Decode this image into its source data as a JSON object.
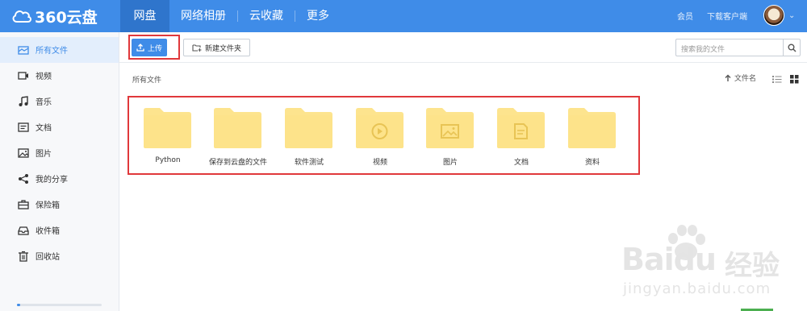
{
  "app": {
    "logo_text": "360云盘",
    "logo_icon": "cloud-icon"
  },
  "nav": {
    "items": [
      {
        "label": "网盘",
        "active": true
      },
      {
        "label": "网络相册",
        "active": false
      },
      {
        "label": "云收藏",
        "active": false
      },
      {
        "label": "更多",
        "active": false
      }
    ]
  },
  "header": {
    "member_label": "会员",
    "download_client_label": "下载客户端",
    "avatar_icon": "user-avatar"
  },
  "sidebar": {
    "items": [
      {
        "label": "所有文件",
        "icon": "all-files-icon",
        "active": true
      },
      {
        "label": "视频",
        "icon": "video-icon",
        "active": false
      },
      {
        "label": "音乐",
        "icon": "music-icon",
        "active": false
      },
      {
        "label": "文档",
        "icon": "document-icon",
        "active": false
      },
      {
        "label": "图片",
        "icon": "image-icon",
        "active": false
      },
      {
        "label": "我的分享",
        "icon": "share-icon",
        "active": false
      },
      {
        "label": "保险箱",
        "icon": "safe-box-icon",
        "active": false
      },
      {
        "label": "收件箱",
        "icon": "inbox-icon",
        "active": false
      },
      {
        "label": "回收站",
        "icon": "trash-icon",
        "active": false
      }
    ]
  },
  "toolbar": {
    "upload_label": "上传",
    "new_folder_label": "新建文件夹",
    "search_placeholder": "搜索我的文件"
  },
  "content": {
    "breadcrumb": "所有文件",
    "sort_label": "文件名",
    "files": [
      {
        "name": "Python",
        "type": "folder",
        "icon": "folder-icon"
      },
      {
        "name": "保存到云盘的文件",
        "type": "folder",
        "icon": "folder-icon"
      },
      {
        "name": "软件测试",
        "type": "folder",
        "icon": "folder-icon"
      },
      {
        "name": "视频",
        "type": "folder",
        "icon": "folder-video-icon"
      },
      {
        "name": "图片",
        "type": "folder",
        "icon": "folder-image-icon"
      },
      {
        "name": "文档",
        "type": "folder",
        "icon": "folder-document-icon"
      },
      {
        "name": "资料",
        "type": "folder",
        "icon": "folder-icon"
      }
    ]
  },
  "watermark": {
    "brand": "Baidu",
    "brand_cn": "经验",
    "url": "jingyan.baidu.com"
  },
  "colors": {
    "primary": "#3f8ce8",
    "folder": "#fde48e",
    "highlight": "#e0383b"
  }
}
